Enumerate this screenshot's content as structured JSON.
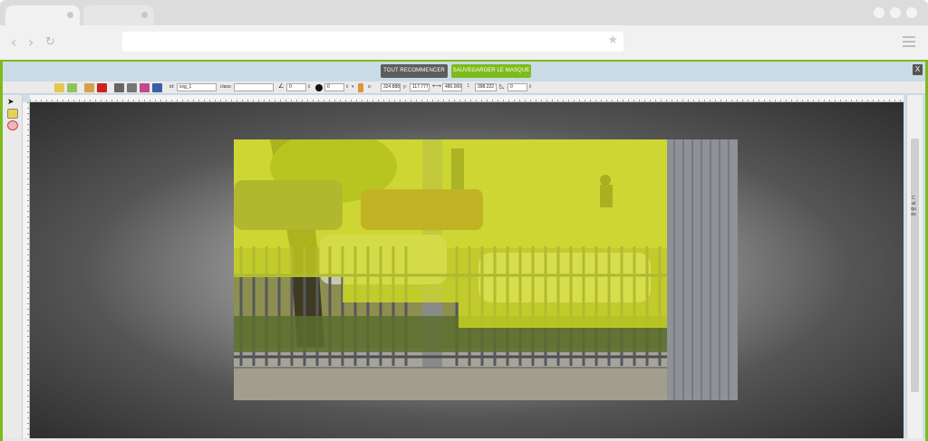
{
  "app": {
    "buttons": {
      "reset_label": "TOUT RECOMMENCER",
      "save_label": "SAUVEGARDER LE MASQUE",
      "close_label": "X"
    }
  },
  "toolbar": {
    "id_label": "id:",
    "id_value": "svg_1",
    "class_label": "class:",
    "class_value": "",
    "angle_value": "0",
    "blur_value": "0",
    "x_label": "x:",
    "x_value": "324.888",
    "y_label": "y:",
    "y_value": "117.777",
    "width_value": "480.000",
    "height_value": "398.222",
    "corner_value": "0"
  },
  "layers_panel": {
    "label": "Calques"
  },
  "colors": {
    "accent_green": "#7dbb1c",
    "reset_gray": "#5d5d5d",
    "mask_yellow": "#d7e21f"
  },
  "icons": [
    "back-icon",
    "forward-icon",
    "reload-icon",
    "star-icon",
    "menu-icon",
    "close-icon",
    "undo-icon",
    "redo-icon",
    "clone-icon",
    "delete-icon",
    "align-icon",
    "move-icon",
    "angle-icon",
    "blur-icon",
    "width-icon",
    "height-icon",
    "corner-icon",
    "select-tool-icon",
    "rect-tool-icon",
    "ellipse-tool-icon"
  ]
}
